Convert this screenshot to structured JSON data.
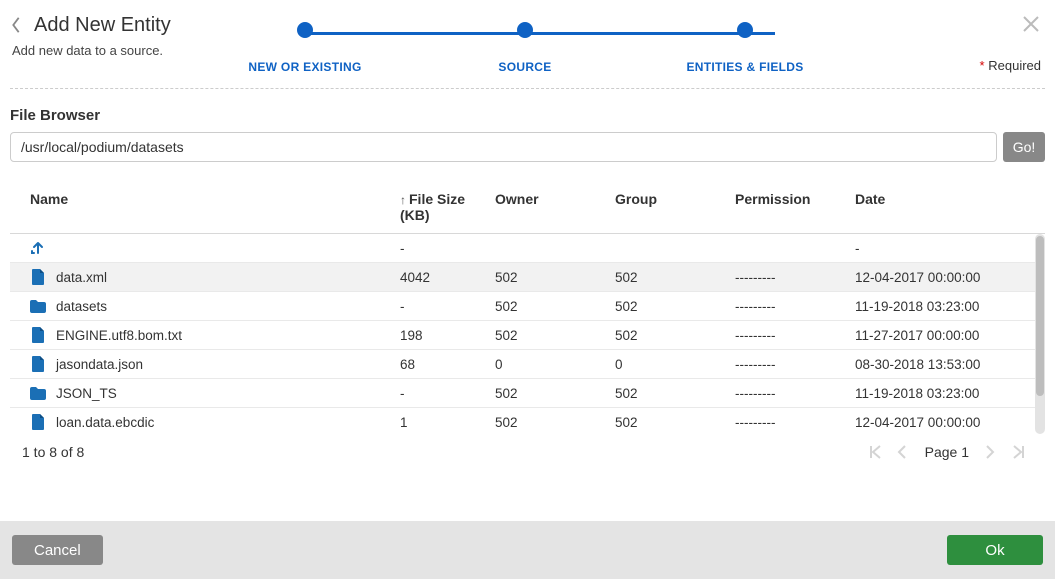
{
  "header": {
    "title": "Add New Entity",
    "subtitle": "Add new data to a source.",
    "required_label": "Required"
  },
  "stepper": {
    "steps": [
      {
        "label": "NEW OR EXISTING",
        "active": true
      },
      {
        "label": "SOURCE",
        "active": true
      },
      {
        "label": "ENTITIES & FIELDS",
        "active": true
      }
    ]
  },
  "browser": {
    "section_label": "File Browser",
    "path": "/usr/local/podium/datasets",
    "go_label": "Go!"
  },
  "table": {
    "columns": {
      "name": "Name",
      "size": "File Size (KB)",
      "owner": "Owner",
      "group": "Group",
      "permission": "Permission",
      "date": "Date"
    },
    "sort": {
      "column": "size",
      "direction": "asc"
    },
    "rows": [
      {
        "type": "up",
        "name": "",
        "size": "-",
        "owner": "",
        "group": "",
        "permission": "",
        "date": "-"
      },
      {
        "type": "file",
        "name": "data.xml",
        "size": "4042",
        "owner": "502",
        "group": "502",
        "permission": "---------",
        "date": "12-04-2017 00:00:00",
        "selected": true
      },
      {
        "type": "folder",
        "name": "datasets",
        "size": "-",
        "owner": "502",
        "group": "502",
        "permission": "---------",
        "date": "11-19-2018 03:23:00"
      },
      {
        "type": "file",
        "name": "ENGINE.utf8.bom.txt",
        "size": "198",
        "owner": "502",
        "group": "502",
        "permission": "---------",
        "date": "11-27-2017 00:00:00"
      },
      {
        "type": "file",
        "name": "jasondata.json",
        "size": "68",
        "owner": "0",
        "group": "0",
        "permission": "---------",
        "date": "08-30-2018 13:53:00"
      },
      {
        "type": "folder",
        "name": "JSON_TS",
        "size": "-",
        "owner": "502",
        "group": "502",
        "permission": "---------",
        "date": "11-19-2018 03:23:00"
      },
      {
        "type": "file",
        "name": "loan.data.ebcdic",
        "size": "1",
        "owner": "502",
        "group": "502",
        "permission": "---------",
        "date": "12-04-2017 00:00:00"
      }
    ]
  },
  "pager": {
    "summary": "1 to 8 of 8",
    "page_label": "Page",
    "page": "1"
  },
  "footer": {
    "cancel": "Cancel",
    "ok": "Ok"
  },
  "colors": {
    "accent": "#0f62c4",
    "ok_button": "#2e8f3e",
    "grey_button": "#888888"
  }
}
